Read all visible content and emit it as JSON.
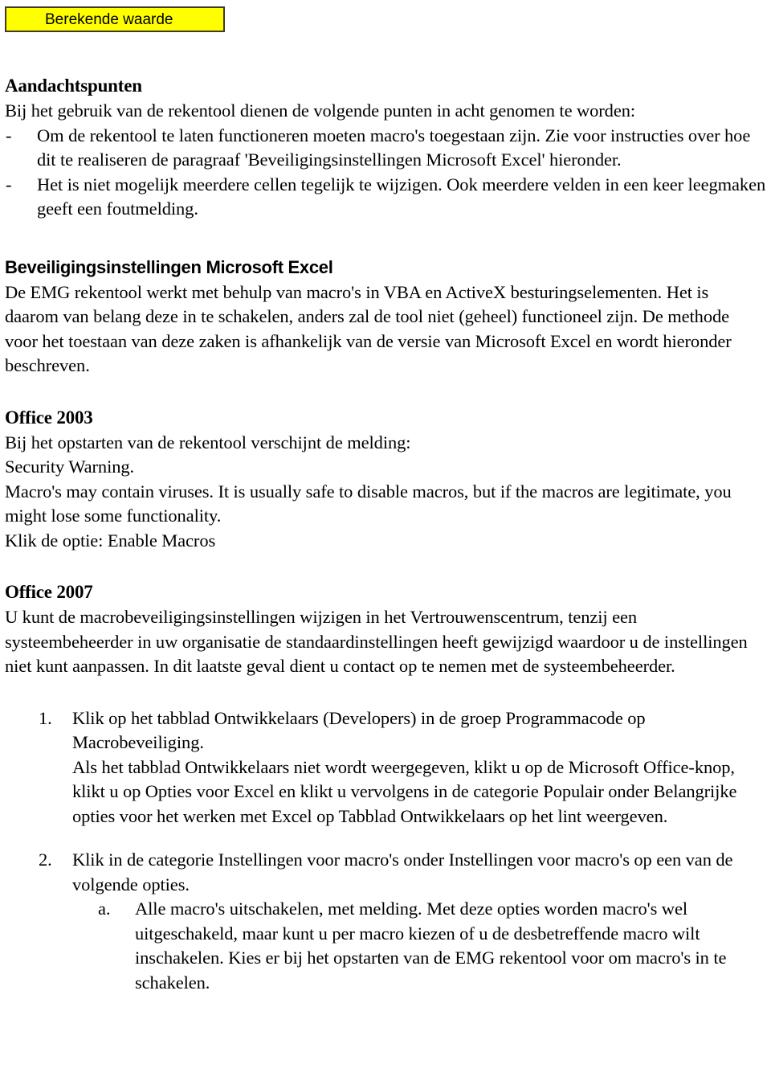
{
  "callout": {
    "label": "Berekende waarde",
    "background_color": "#ffff00",
    "border_color": "#3d3a26"
  },
  "document": {
    "section_attention": {
      "heading": "Aandachtspunten",
      "intro": "Bij het gebruik van de rekentool dienen de volgende punten in acht genomen te worden:",
      "bullets": [
        {
          "marker": "-",
          "text": "Om de rekentool te laten functioneren moeten macro's toegestaan zijn. Zie voor instructies over hoe dit te realiseren de paragraaf 'Beveiligingsinstellingen Microsoft Excel' hieronder."
        },
        {
          "marker": "-",
          "text": "Het is niet mogelijk meerdere cellen tegelijk te wijzigen. Ook meerdere velden in een keer leegmaken geeft een foutmelding."
        }
      ]
    },
    "section_security": {
      "heading": "Beveiligingsinstellingen Microsoft Excel",
      "paragraph": "De EMG rekentool werkt met behulp van macro's in VBA en ActiveX besturingselementen. Het is daarom van belang deze in te schakelen, anders zal de tool niet (geheel) functioneel zijn. De methode voor het toestaan van deze zaken is afhankelijk van de versie van Microsoft Excel en wordt hieronder beschreven."
    },
    "section_office_2003": {
      "heading": "Office 2003",
      "lines": [
        "Bij het opstarten van de rekentool verschijnt de melding:",
        "Security Warning.",
        "Macro's may contain viruses. It is usually safe to disable macros, but if the macros are legitimate, you might lose some functionality.",
        "Klik de optie: Enable Macros"
      ]
    },
    "section_office_2007": {
      "heading": "Office 2007",
      "paragraph": "U kunt de macrobeveiligingsinstellingen wijzigen in het Vertrouwenscentrum, tenzij een systeembeheerder in uw organisatie de standaardinstellingen heeft gewijzigd waardoor u de instellingen niet kunt aanpassen. In dit laatste geval dient u contact op te nemen met de systeembeheerder.",
      "steps": [
        {
          "marker": "1.",
          "paragraphs": [
            "Klik op het tabblad Ontwikkelaars (Developers) in de groep Programmacode op Macrobeveiliging.",
            "Als het tabblad Ontwikkelaars niet wordt weergegeven, klikt u op de Microsoft Office-knop, klikt u op Opties voor Excel en klikt u vervolgens in de categorie Populair onder Belangrijke opties voor het werken met Excel op Tabblad Ontwikkelaars op het lint weergeven."
          ],
          "substeps": []
        },
        {
          "marker": "2.",
          "paragraphs": [
            "Klik in de categorie Instellingen voor macro's onder Instellingen voor macro's op een van de volgende opties."
          ],
          "substeps": [
            {
              "marker": "a.",
              "text": "Alle macro's uitschakelen, met melding. Met deze opties worden macro's wel uitgeschakeld, maar kunt u per macro kiezen of u de desbetreffende macro wilt inschakelen. Kies er bij het opstarten van de EMG rekentool voor om macro's in te schakelen."
            }
          ]
        }
      ]
    }
  }
}
